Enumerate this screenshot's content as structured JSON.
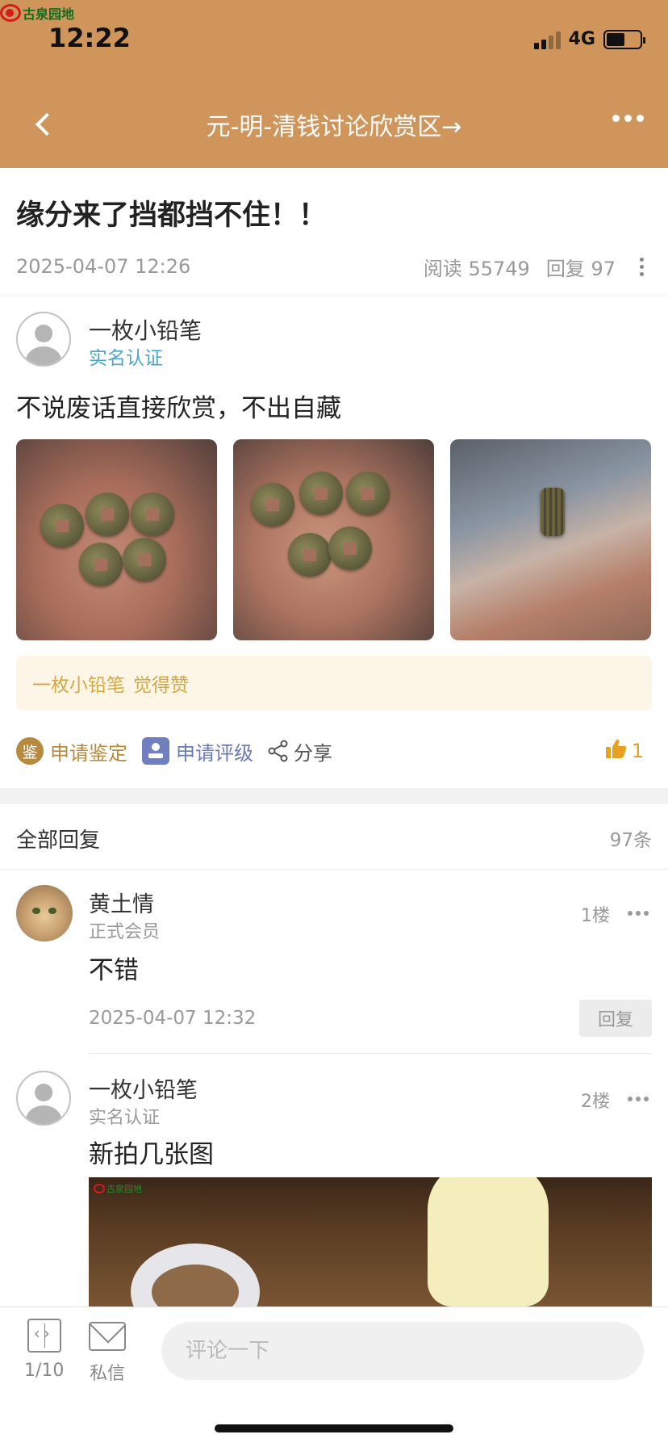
{
  "status_bar": {
    "app_logo_text": "古泉园地",
    "time": "12:22",
    "network": "4G",
    "battery_level": 0.55
  },
  "header": {
    "title": "元-明-清钱讨论欣赏区→"
  },
  "post": {
    "title": "缘分来了挡都挡不住！！",
    "date": "2025-04-07 12:26",
    "read_label": "阅读",
    "read_count": "55749",
    "reply_label": "回复",
    "reply_count": "97",
    "author": {
      "name": "一枚小铅笔",
      "badge": "实名认证"
    },
    "body": "不说废话直接欣赏，不出自藏",
    "images": [
      "coins-in-palm-1",
      "coins-in-palm-2",
      "coin-stack-in-hand"
    ],
    "like_note": {
      "name": "一枚小铅笔",
      "text": "觉得赞"
    },
    "actions": {
      "appraise_icon_text": "鉴",
      "appraise": "申请鉴定",
      "grade": "申请评级",
      "share": "分享",
      "like_count": "1"
    }
  },
  "replies": {
    "header": "全部回复",
    "count": "97条",
    "items": [
      {
        "name": "黄土情",
        "role": "正式会员",
        "floor": "1楼",
        "text": "不错",
        "date": "2025-04-07 12:32",
        "reply_label": "回复"
      },
      {
        "name": "一枚小铅笔",
        "role": "实名认证",
        "floor": "2楼",
        "text": "新拍几张图",
        "image_logo_text": "古泉园地"
      }
    ]
  },
  "bottom_bar": {
    "page_indicator": "1/10",
    "message_label": "私信",
    "comment_placeholder": "评论一下"
  },
  "colors": {
    "header_bg": "#cf955b",
    "verified_blue": "#4aa5c6",
    "gold": "#b98a3d",
    "like_orange": "#e8a021"
  }
}
